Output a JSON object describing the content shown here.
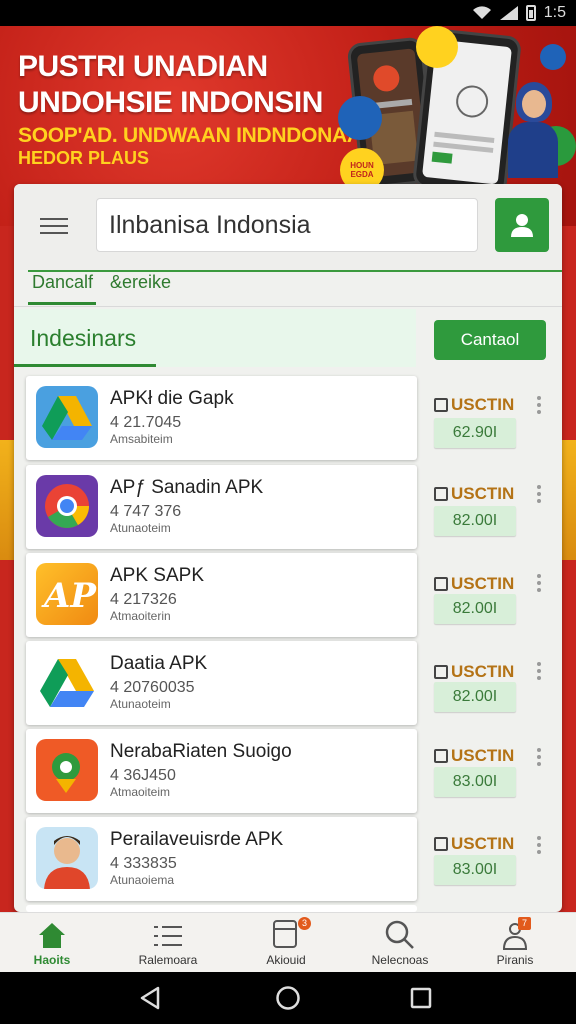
{
  "status_bar": {
    "time": "1:5"
  },
  "banner": {
    "line1": "PUSTRI UNADIAN",
    "line2": "UNDOHSIE INDONSIN",
    "line3": "SOOP'AD. UNDWAAN INDNDONAAN",
    "line4": "HEDOR PLAUS",
    "bubbles": [
      "HOUN EGDA"
    ]
  },
  "search": {
    "value": "Ilnbanisa Indonsia"
  },
  "tabs": [
    {
      "label": "Dancalf"
    },
    {
      "label": "&ereike"
    }
  ],
  "section": {
    "title": "Indesinars",
    "action_label": "Cantaol"
  },
  "apps": [
    {
      "name": "APKł die Gapk",
      "number": "4 21.7045",
      "subtitle": "Amsabiteim",
      "action": "USCTIN",
      "price": "62.90I",
      "icon": "drive-icon"
    },
    {
      "name": "APƒ Sanadin APK",
      "number": "4 747 376",
      "subtitle": "Atunaoteim",
      "action": "USCTIN",
      "price": "82.00I",
      "icon": "chrome-icon"
    },
    {
      "name": "APK SAPK",
      "number": "4 217326",
      "subtitle": "Atmaoiterin",
      "action": "USCTIN",
      "price": "82.00I",
      "icon": "ap-icon"
    },
    {
      "name": "Daatia APK",
      "number": "4 20760035",
      "subtitle": "Atunaoteim",
      "action": "USCTIN",
      "price": "82.00I",
      "icon": "drive-icon"
    },
    {
      "name": "NerabaRiaten Suoigo",
      "number": "4 36J450",
      "subtitle": "Atmaoiteim",
      "action": "USCTIN",
      "price": "83.00I",
      "icon": "maps-icon"
    },
    {
      "name": "Perailaveuisrde APK",
      "number": "4 333835",
      "subtitle": "Atunaoiema",
      "action": "USCTIN",
      "price": "83.00I",
      "icon": "avatar-icon"
    }
  ],
  "bottom_nav": [
    {
      "label": "Haoits",
      "icon": "home-icon"
    },
    {
      "label": "Ralemoara",
      "icon": "list-icon"
    },
    {
      "label": "Akiouid",
      "icon": "tablet-icon",
      "badge": "3"
    },
    {
      "label": "Nelecnoas",
      "icon": "search-icon"
    },
    {
      "label": "Piranis",
      "icon": "person-icon",
      "badge": "7"
    }
  ],
  "colors": {
    "brand_green": "#2f9a3d",
    "banner_red": "#c8261e",
    "accent_yellow": "#ffd21f",
    "action_orange": "#b47316"
  }
}
